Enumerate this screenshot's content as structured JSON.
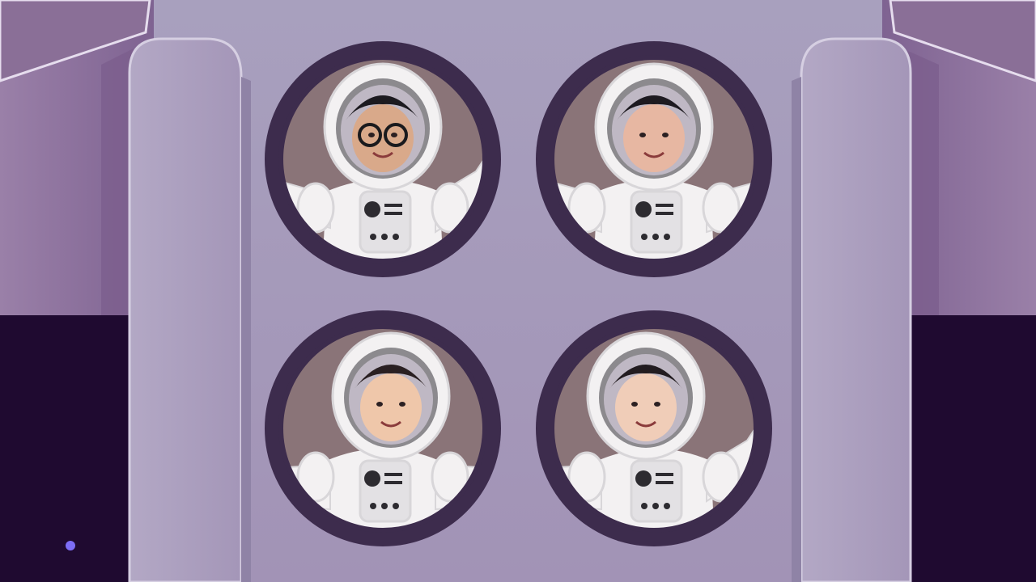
{
  "scene": {
    "title": "",
    "colors": {
      "space": "#1f0a30",
      "hull_side": "#8a6f97",
      "hull_side_light": "#a68cb4",
      "panel": "#a79bba",
      "panel_light": "#b5abc6",
      "panel_dark": "#8f83a6",
      "porthole_ring": "#3d2c4d",
      "porthole_inner": "#8a7478",
      "suit": "#f3f1f2",
      "suit_shadow": "#d8d6d9",
      "suit_stripe": "#c03a44",
      "visor_rim": "#8c8a8e",
      "star": "#7d6df5"
    },
    "portholes": [
      {
        "name": "porthole-top-left",
        "pose": "waving-right-hand",
        "skin": "#d9a98a",
        "hair": "#1c1a1f",
        "glasses": true
      },
      {
        "name": "porthole-top-right",
        "pose": "arms-out",
        "skin": "#e7b7a2",
        "hair": "#1d1a20",
        "glasses": false
      },
      {
        "name": "porthole-bottom-left",
        "pose": "arms-down",
        "skin": "#efc7aa",
        "hair": "#2a2022",
        "glasses": false
      },
      {
        "name": "porthole-bottom-right",
        "pose": "waving-left-arm",
        "skin": "#f0cdb8",
        "hair": "#221c20",
        "glasses": false
      }
    ]
  }
}
